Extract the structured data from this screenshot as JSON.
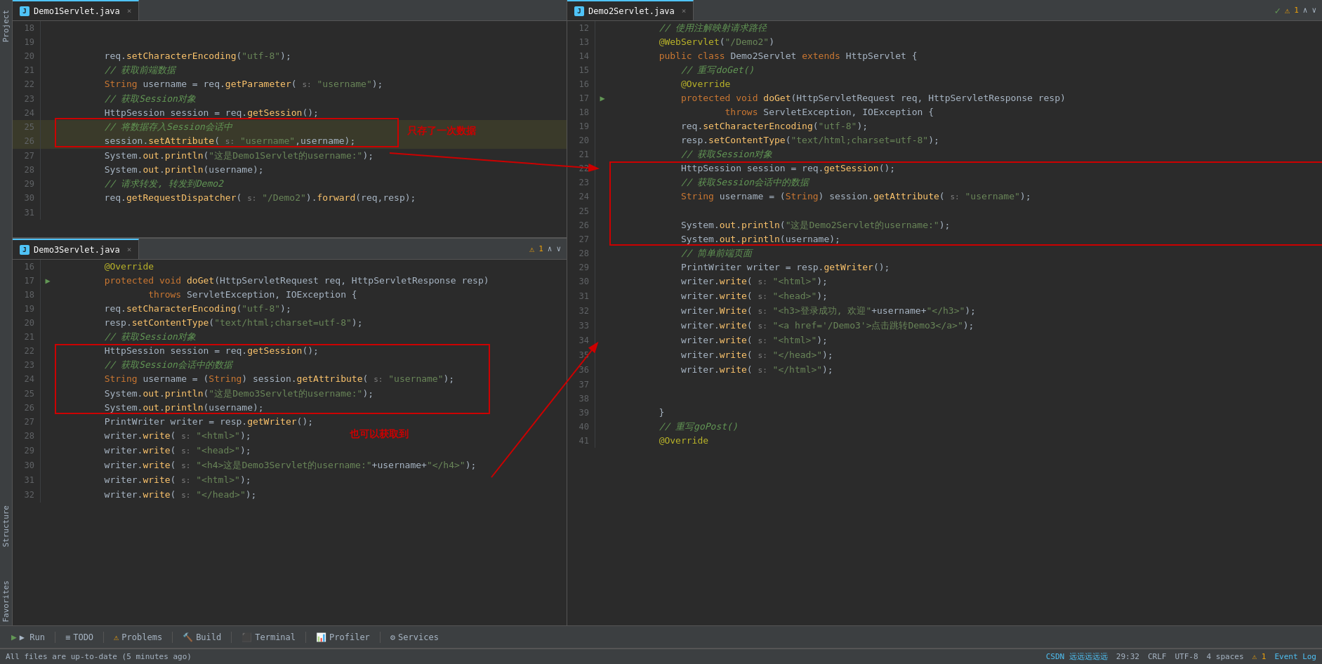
{
  "tabs": {
    "left_top": {
      "label": "Demo1Servlet.java",
      "icon": "J",
      "active": true
    },
    "left_bottom": {
      "label": "Demo3Servlet.java",
      "icon": "J",
      "active": true
    },
    "right": {
      "label": "Demo2Servlet.java",
      "icon": "J",
      "active": true
    }
  },
  "annotations": {
    "only_once": "只存了一次数据",
    "can_get": "可以获取到",
    "also_get": "也可以获取到"
  },
  "bottom_toolbar": {
    "run": "▶ Run",
    "todo": "TODO",
    "problems": "Problems",
    "build": "Build",
    "terminal": "Terminal",
    "profiler": "Profiler",
    "services": "Services"
  },
  "status_bar": {
    "left": "All files are up-to-date (5 minutes ago)",
    "position": "29:32",
    "line_endings": "CRLF",
    "encoding": "UTF-8",
    "indent": "4 spaces",
    "warnings": "⚠ 1",
    "event_log": "Event Log",
    "csdn": "CSDN 远远远远远"
  },
  "left_top_lines": [
    {
      "num": 18,
      "content": ""
    },
    {
      "num": 19,
      "content": ""
    },
    {
      "num": 20,
      "content": "        req.setCharacterEncoding(\"utf-8\");"
    },
    {
      "num": 21,
      "content": "        // 获取前端数据"
    },
    {
      "num": 22,
      "content": "        String username = req.getParameter( s: \"username\");"
    },
    {
      "num": 23,
      "content": "        // 获取Session对象"
    },
    {
      "num": 24,
      "content": "        HttpSession session = req.getSession();"
    },
    {
      "num": 25,
      "content": "        // 将数据存入Session会话中",
      "highlighted": true
    },
    {
      "num": 26,
      "content": "        session.setAttribute( s: \"username\",username);",
      "highlighted": true
    },
    {
      "num": 27,
      "content": "        System.out.println(\"这是Demo1Servlet的username:\");"
    },
    {
      "num": 28,
      "content": "        System.out.println(username);"
    },
    {
      "num": 29,
      "content": "        // 请求转发, 转发到Demo2"
    },
    {
      "num": 30,
      "content": "        req.getRequestDispatcher( s: \"/Demo2\").forward(req,resp);"
    },
    {
      "num": 31,
      "content": ""
    }
  ],
  "left_bottom_lines": [
    {
      "num": 16,
      "content": "        @Override"
    },
    {
      "num": 17,
      "content": "        protected void doGet(HttpServletRequest req, HttpServletResponse resp)",
      "gutter": "run"
    },
    {
      "num": 18,
      "content": "                throws ServletException, IOException {"
    },
    {
      "num": 19,
      "content": "        req.setCharacterEncoding(\"utf-8\");"
    },
    {
      "num": 20,
      "content": "        resp.setContentType(\"text/html;charset=utf-8\");"
    },
    {
      "num": 21,
      "content": "        // 获取Session对象"
    },
    {
      "num": 22,
      "content": "        HttpSession session = req.getSession();"
    },
    {
      "num": 23,
      "content": "        // 获取Session会话中的数据"
    },
    {
      "num": 24,
      "content": "        String username = (String) session.getAttribute( s: \"username\");"
    },
    {
      "num": 25,
      "content": "        System.out.println(\"这是Demo3Servlet的username:\");"
    },
    {
      "num": 26,
      "content": "        System.out.println(username);"
    },
    {
      "num": 27,
      "content": "        PrintWriter writer = resp.getWriter();"
    },
    {
      "num": 28,
      "content": "        writer.write( s: \"<html>\");"
    },
    {
      "num": 29,
      "content": "        writer.write( s: \"<head>\");"
    },
    {
      "num": 30,
      "content": "        writer.write( s: \"<h4>这是Demo3Servlet的username:\"+username+\"</h4>\");"
    },
    {
      "num": 31,
      "content": "        writer.write( s: \"<html>\");"
    },
    {
      "num": 32,
      "content": "        writer.write( s: \"</head>\");"
    }
  ],
  "right_lines": [
    {
      "num": 12,
      "content": "        // 使用注解映射请求路径"
    },
    {
      "num": 13,
      "content": "        @WebServlet(\"/Demo2\")"
    },
    {
      "num": 14,
      "content": "        public class Demo2Servlet extends HttpServlet {"
    },
    {
      "num": 15,
      "content": "            // 重写doGet()"
    },
    {
      "num": 16,
      "content": "            @Override"
    },
    {
      "num": 17,
      "content": "            protected void doGet(HttpServletRequest req, HttpServletResponse resp)",
      "gutter": "run"
    },
    {
      "num": 18,
      "content": "                    throws ServletException, IOException {"
    },
    {
      "num": 19,
      "content": "            req.setCharacterEncoding(\"utf-8\");"
    },
    {
      "num": 20,
      "content": "            resp.setContentType(\"text/html;charset=utf-8\");"
    },
    {
      "num": 21,
      "content": "            // 获取Session对象"
    },
    {
      "num": 22,
      "content": "            HttpSession session = req.getSession();"
    },
    {
      "num": 23,
      "content": "            // 获取Session会话中的数据"
    },
    {
      "num": 24,
      "content": "            String username = (String) session.getAttribute( s: \"username\");"
    },
    {
      "num": 25,
      "content": ""
    },
    {
      "num": 26,
      "content": "            System.out.println(\"这是Demo2Servlet的username:\");"
    },
    {
      "num": 27,
      "content": "            System.out.println(username);"
    },
    {
      "num": 28,
      "content": "            // 简单前端页面"
    },
    {
      "num": 29,
      "content": "            PrintWriter writer = resp.getWriter();"
    },
    {
      "num": 30,
      "content": "            writer.write( s: \"<html>\");"
    },
    {
      "num": 31,
      "content": "            writer.write( s: \"<head>\");"
    },
    {
      "num": 32,
      "content": "            writer.Write( s: \"<h3>登录成功, 欢迎\"+username+\"</h3>\");"
    },
    {
      "num": 33,
      "content": "            writer.write( s: \"<a href='/Demo3'>点击跳转Demo3</a>\");"
    },
    {
      "num": 34,
      "content": "            writer.write( s: \"<html>\");"
    },
    {
      "num": 35,
      "content": "            writer.write( s: \"</head>\");"
    },
    {
      "num": 36,
      "content": "            writer.write( s: \"</html>\");"
    },
    {
      "num": 37,
      "content": ""
    },
    {
      "num": 38,
      "content": ""
    },
    {
      "num": 39,
      "content": "        }"
    },
    {
      "num": 40,
      "content": "        // 重写goPost()"
    },
    {
      "num": 41,
      "content": "        @Override"
    }
  ]
}
